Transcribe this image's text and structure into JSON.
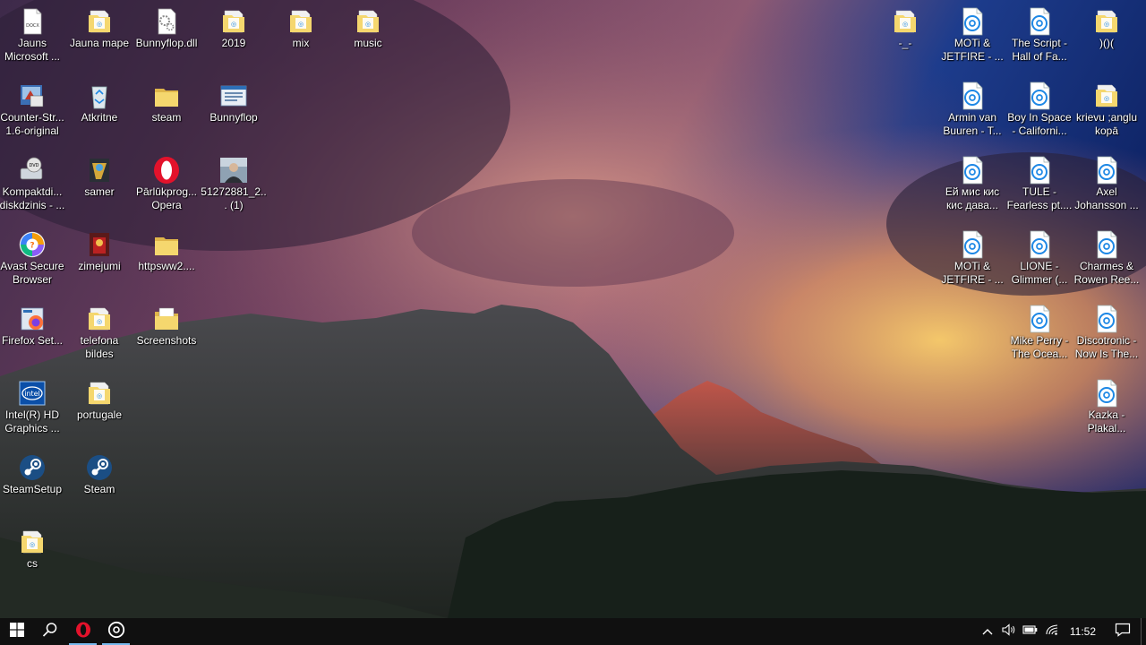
{
  "desktop": {
    "icons": [
      {
        "id": "jauns-docx",
        "label": "Jauns Microsoft ...",
        "type": "docx",
        "col": 0,
        "row": 0
      },
      {
        "id": "jauna-mape",
        "label": "Jauna mape",
        "type": "folder",
        "col": 1,
        "row": 0
      },
      {
        "id": "bunnyflop-dll",
        "label": "Bunnyflop.dll",
        "type": "dll",
        "col": 2,
        "row": 0
      },
      {
        "id": "folder-2019",
        "label": "2019",
        "type": "folder",
        "col": 3,
        "row": 0
      },
      {
        "id": "folder-mix",
        "label": "mix",
        "type": "folder",
        "col": 4,
        "row": 0
      },
      {
        "id": "folder-music",
        "label": "music",
        "type": "folder",
        "col": 5,
        "row": 0
      },
      {
        "id": "counter-strike",
        "label": "Counter-Str... 1.6-original",
        "type": "cs",
        "col": 0,
        "row": 1
      },
      {
        "id": "atkritne",
        "label": "Atkritne",
        "type": "recycle",
        "col": 1,
        "row": 1
      },
      {
        "id": "folder-steam",
        "label": "steam",
        "type": "folder-plain",
        "col": 2,
        "row": 1
      },
      {
        "id": "bunnyflop",
        "label": "Bunnyflop",
        "type": "window",
        "col": 3,
        "row": 1
      },
      {
        "id": "kompaktdisks",
        "label": "Kompaktdi... diskdzinis - ...",
        "type": "dvd",
        "col": 0,
        "row": 2
      },
      {
        "id": "samer",
        "label": "samer",
        "type": "game",
        "col": 1,
        "row": 2
      },
      {
        "id": "opera",
        "label": "Pārlūkprog... Opera",
        "type": "opera",
        "col": 2,
        "row": 2
      },
      {
        "id": "photo-5127",
        "label": "51272881_2... (1)",
        "type": "photo",
        "col": 3,
        "row": 2
      },
      {
        "id": "avast",
        "label": "Avast Secure Browser",
        "type": "avast",
        "col": 0,
        "row": 3
      },
      {
        "id": "zimejumi",
        "label": "zimejumi",
        "type": "game2",
        "col": 1,
        "row": 3
      },
      {
        "id": "httpsww2",
        "label": "httpsww2....",
        "type": "folder-plain",
        "col": 2,
        "row": 3
      },
      {
        "id": "firefox-setup",
        "label": "Firefox Set...",
        "type": "setup",
        "col": 0,
        "row": 4
      },
      {
        "id": "telefona-bildes",
        "label": "telefona bildes",
        "type": "folder",
        "col": 1,
        "row": 4
      },
      {
        "id": "screenshots",
        "label": "Screenshots",
        "type": "folder-doc",
        "col": 2,
        "row": 4
      },
      {
        "id": "intel-hd",
        "label": "Intel(R) HD Graphics ...",
        "type": "intel",
        "col": 0,
        "row": 5
      },
      {
        "id": "portugale",
        "label": "portugale",
        "type": "folder",
        "col": 1,
        "row": 5
      },
      {
        "id": "steamsetup",
        "label": "SteamSetup",
        "type": "steam",
        "col": 0,
        "row": 6
      },
      {
        "id": "steam",
        "label": "Steam",
        "type": "steam",
        "col": 1,
        "row": 6
      },
      {
        "id": "folder-cs",
        "label": "cs",
        "type": "folder",
        "col": 0,
        "row": 7
      },
      {
        "id": "folder-dash",
        "label": "-_-",
        "type": "folder",
        "col": 13,
        "row": 0
      },
      {
        "id": "moti-jetfire-1",
        "label": "MOTi & JETFIRE - ...",
        "type": "groove",
        "col": 14,
        "row": 0
      },
      {
        "id": "the-script",
        "label": "The Script - Hall of Fa...",
        "type": "groove",
        "col": 15,
        "row": 0
      },
      {
        "id": "folder-paren",
        "label": ")()(",
        "type": "folder",
        "col": 16,
        "row": 0
      },
      {
        "id": "armin",
        "label": "Armin van Buuren - T...",
        "type": "groove",
        "col": 14,
        "row": 1
      },
      {
        "id": "boy-in-space",
        "label": "Boy In Space - Californi...",
        "type": "groove",
        "col": 15,
        "row": 1
      },
      {
        "id": "krievu",
        "label": "krievu ;anglu kopā",
        "type": "folder",
        "col": 16,
        "row": 1
      },
      {
        "id": "ei-mis",
        "label": "Ей мис кис кис дава...",
        "type": "groove",
        "col": 14,
        "row": 2
      },
      {
        "id": "tule",
        "label": "TULE - Fearless pt....",
        "type": "groove",
        "col": 15,
        "row": 2
      },
      {
        "id": "axel",
        "label": "Axel Johansson ...",
        "type": "groove",
        "col": 16,
        "row": 2
      },
      {
        "id": "moti-jetfire-2",
        "label": "MOTi & JETFIRE - ...",
        "type": "groove",
        "col": 14,
        "row": 3
      },
      {
        "id": "lione",
        "label": "LIONE - Glimmer (...",
        "type": "groove",
        "col": 15,
        "row": 3
      },
      {
        "id": "charmes",
        "label": "Charmes & Rowen Ree...",
        "type": "groove",
        "col": 16,
        "row": 3
      },
      {
        "id": "mike-perry",
        "label": "Mike Perry - The Ocea...",
        "type": "groove",
        "col": 15,
        "row": 4
      },
      {
        "id": "discotronic",
        "label": "Discotronic - Now Is The...",
        "type": "groove",
        "col": 16,
        "row": 4
      },
      {
        "id": "kazka",
        "label": "Kazka - Plakal...",
        "type": "groove",
        "col": 16,
        "row": 5
      }
    ]
  },
  "taskbar": {
    "clock": "11:52",
    "pinned": [
      "start",
      "search",
      "opera",
      "groove"
    ]
  },
  "colors": {
    "folder": "#f5d76e",
    "groove_blue": "#1e88e5",
    "opera_red": "#e3122b",
    "taskbar": "#101010",
    "active_underline": "#76b9ed"
  }
}
